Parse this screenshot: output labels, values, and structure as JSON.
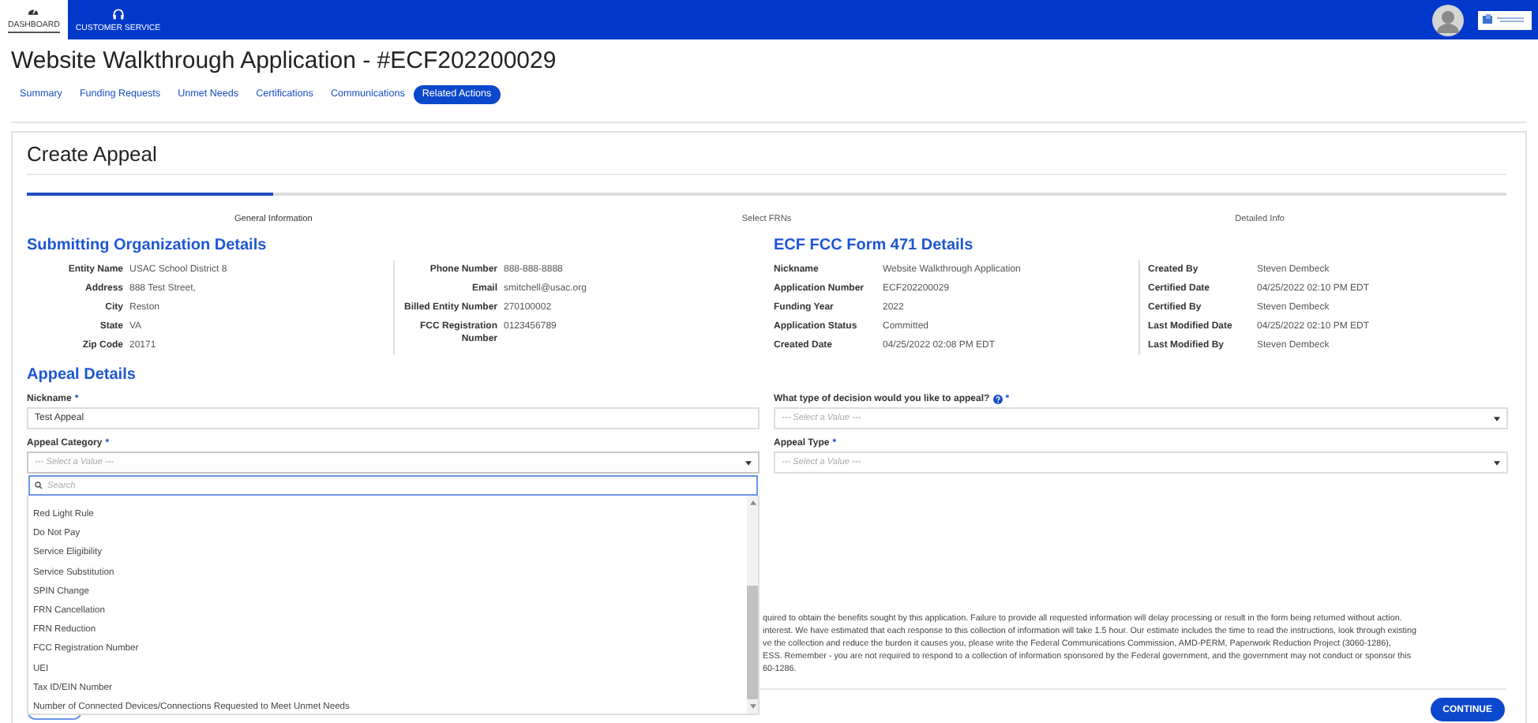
{
  "top_nav": {
    "tabs": [
      {
        "label": "DASHBOARD",
        "kind": "dashboard",
        "selected": true
      },
      {
        "label": "CUSTOMER SERVICE",
        "kind": "headset",
        "selected": false
      }
    ]
  },
  "page_title": "Website Walkthrough Application - #ECF202200029",
  "tabs": [
    {
      "label": "Summary",
      "selected": false
    },
    {
      "label": "Funding Requests",
      "selected": false
    },
    {
      "label": "Unmet Needs",
      "selected": false
    },
    {
      "label": "Certifications",
      "selected": false
    },
    {
      "label": "Communications",
      "selected": false
    },
    {
      "label": "Related Actions",
      "selected": true
    }
  ],
  "card_title": "Create Appeal",
  "steps": [
    {
      "label": "General Information",
      "selected": true
    },
    {
      "label": "Select FRNs",
      "selected": false
    },
    {
      "label": "Detailed Info",
      "selected": false
    }
  ],
  "organization": {
    "heading": "Submitting Organization Details",
    "column_1": [
      {
        "label": "Entity Name",
        "value": "USAC School District 8"
      },
      {
        "label": "Address",
        "value": "888 Test Street,"
      },
      {
        "label": "City",
        "value": "Reston"
      },
      {
        "label": "State",
        "value": "VA"
      },
      {
        "label": "Zip Code",
        "value": "20171"
      }
    ],
    "column_2": [
      {
        "label": "Phone Number",
        "value": "888-888-8888"
      },
      {
        "label": "Email",
        "value": "smitchell@usac.org"
      },
      {
        "label": "Billed Entity Number",
        "value": "270100002"
      },
      {
        "label": "FCC Registration Number",
        "value": "0123456789"
      }
    ]
  },
  "form_471": {
    "heading": "ECF FCC Form 471 Details",
    "column_1": [
      {
        "label": "Nickname",
        "value": "Website Walkthrough Application"
      },
      {
        "label": "Application Number",
        "value": "ECF202200029"
      },
      {
        "label": "Funding Year",
        "value": "2022"
      },
      {
        "label": "Application Status",
        "value": "Committed"
      },
      {
        "label": "Created Date",
        "value": "04/25/2022 02:08 PM EDT"
      }
    ],
    "column_2": [
      {
        "label": "Created By",
        "value": "Steven Dembeck"
      },
      {
        "label": "Certified Date",
        "value": "04/25/2022 02:10 PM EDT"
      },
      {
        "label": "Certified By",
        "value": "Steven Dembeck"
      },
      {
        "label": "Last Modified Date",
        "value": "04/25/2022 02:10 PM EDT"
      },
      {
        "label": "Last Modified By",
        "value": "Steven Dembeck"
      }
    ]
  },
  "appeal_details": {
    "heading": "Appeal Details",
    "nickname": {
      "label": "Nickname",
      "mark": "*",
      "value": "Test Appeal"
    },
    "decision": {
      "label": "What type of decision would you like to appeal?",
      "mark": "*",
      "placeholder": "--- Select a Value ---"
    },
    "category": {
      "label": "Appeal Category",
      "mark": "*",
      "placeholder": "--- Select a Value ---",
      "expanded": true,
      "search_placeholder": "Search",
      "options": [
        "Red Light Rule",
        "Do Not Pay",
        "Service Eligibility",
        "Service Substitution",
        "SPIN Change",
        "FRN Cancellation",
        "FRN Reduction",
        "FCC Registration Number",
        "UEI",
        "Tax ID/EIN Number",
        "Number of Connected Devices/Connections Requested to Meet Unmet Needs"
      ]
    },
    "appeal_type": {
      "label": "Appeal Type",
      "mark": "*",
      "placeholder": "--- Select a Value ---"
    }
  },
  "disclaimer_lines": [
    "quired to obtain the benefits sought by this application. Failure to provide all requested information will delay processing or result in the form being returned without action.",
    "interest. We have estimated that each response to this collection of information will take 1.5 hour. Our estimate includes the time to read the instructions, look through existing",
    "ve the collection and reduce the burden it causes you, please write the Federal Communications Commission, AMD-PERM, Paperwork Reduction Project (3060-1286),",
    "ESS. Remember - you are not required to respond to a collection of information sponsored by the Federal government, and the government may not conduct or sponsor this",
    "60-1286."
  ],
  "continue_button": "CONTINUE"
}
